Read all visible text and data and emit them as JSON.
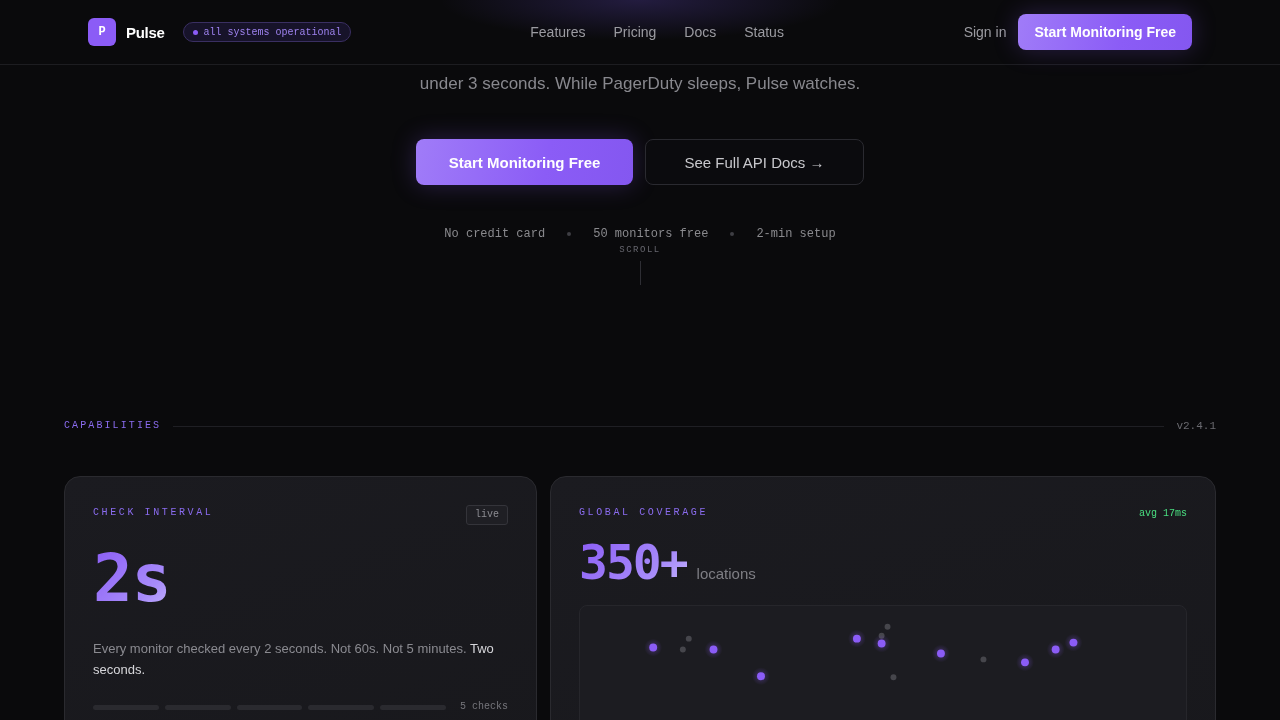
{
  "nav": {
    "logo_letter": "P",
    "brand": "Pulse",
    "status_badge": "all systems operational",
    "links": [
      "Features",
      "Pricing",
      "Docs",
      "Status"
    ],
    "sign_in": "Sign in",
    "cta": "Start Monitoring Free"
  },
  "hero": {
    "subtitle": "under 3 seconds. While PagerDuty sleeps, Pulse watches.",
    "buttons": [
      {
        "label": "Start Monitoring Free",
        "kind": "primary"
      },
      {
        "label": "See Full API Docs →",
        "kind": "secondary"
      }
    ],
    "perks": [
      "No credit card",
      "50 monitors free",
      "2-min setup"
    ],
    "scroll_hint": "SCROLL"
  },
  "section": {
    "label": "CAPABILITIES",
    "version": "v2.4.1"
  },
  "cards": [
    {
      "kind": "interval",
      "label": "CHECK INTERVAL",
      "tag": "live",
      "value": "2s",
      "description": "Every monitor checked every 2 seconds. Not 60s. Not 5 minutes. **Two seconds.**",
      "segments": [
        {
          "active": false
        },
        {
          "active": false
        },
        {
          "active": false
        },
        {
          "active": false
        },
        {
          "active": false
        }
      ],
      "segments_label": "5 checks"
    },
    {
      "kind": "coverage",
      "label": "GLOBAL COVERAGE",
      "tag": "avg 17ms",
      "value": "350+",
      "unit": "locations"
    }
  ]
}
